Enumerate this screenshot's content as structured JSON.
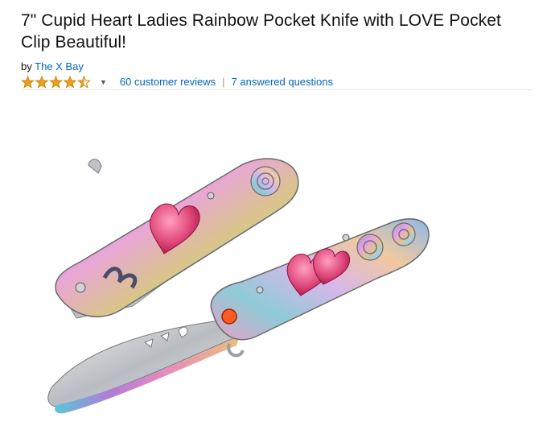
{
  "product": {
    "title": "7\" Cupid Heart Ladies Rainbow Pocket Knife with LOVE Pocket Clip Beautiful!",
    "byline_prefix": "by",
    "brand": "The X Bay",
    "rating_stars": 4.5,
    "review_count_label": "60 customer reviews",
    "separator": "|",
    "questions_label": "7 answered questions"
  },
  "colors": {
    "link": "#0066c0",
    "star": "#f0a01a",
    "star_outline": "#c78a12",
    "heart": "#e0487a"
  },
  "icons": {
    "rating": "star-icon",
    "dropdown": "caret-down-icon"
  }
}
